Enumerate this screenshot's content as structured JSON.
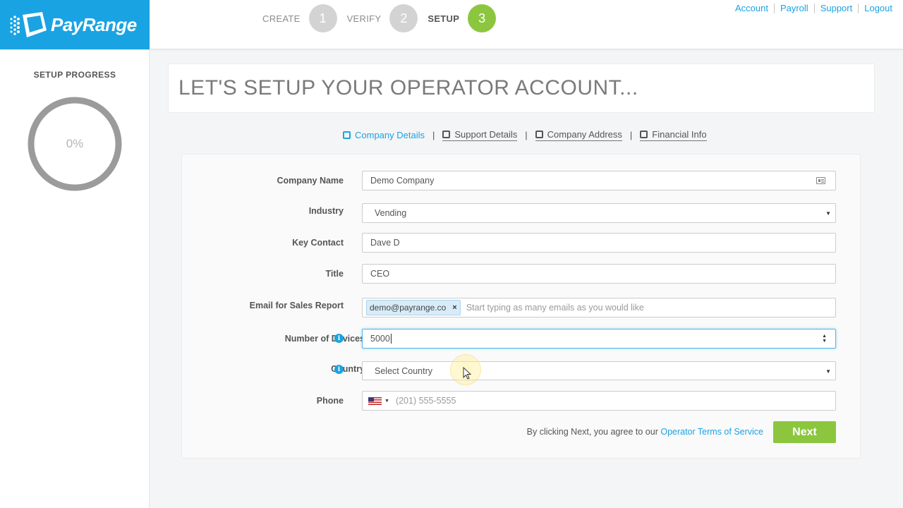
{
  "brand": {
    "name": "PayRange",
    "color": "#1aa3e3",
    "accent": "#8cc63f"
  },
  "steps": [
    {
      "label": "CREATE",
      "number": "1",
      "active": false
    },
    {
      "label": "VERIFY",
      "number": "2",
      "active": false
    },
    {
      "label": "SETUP",
      "number": "3",
      "active": true
    }
  ],
  "top_links": [
    "Account",
    "Payroll",
    "Support",
    "Logout"
  ],
  "sidebar": {
    "title": "SETUP PROGRESS",
    "progress_text": "0%",
    "progress_value": 0
  },
  "main": {
    "title": "LET'S SETUP YOUR OPERATOR ACCOUNT...",
    "tabs": [
      "Company Details",
      "Support Details",
      "Company Address",
      "Financial Info"
    ],
    "active_tab": "Company Details"
  },
  "form": {
    "company_name": {
      "label": "Company Name",
      "value": "Demo Company"
    },
    "industry": {
      "label": "Industry",
      "value": "Vending"
    },
    "key_contact": {
      "label": "Key Contact",
      "value": "Dave D"
    },
    "title": {
      "label": "Title",
      "value": "CEO"
    },
    "email": {
      "label": "Email for Sales Report",
      "tag": "demo@payrange.co",
      "placeholder": "Start typing as many emails as you would like"
    },
    "devices": {
      "label": "Number of Devices",
      "value": "5000"
    },
    "country": {
      "label": "Country",
      "placeholder": "Select Country"
    },
    "phone": {
      "label": "Phone",
      "placeholder": "(201) 555-5555",
      "flag": "us-flag-icon"
    }
  },
  "footer": {
    "agree_text": "By clicking Next, you agree to our ",
    "terms_link": "Operator Terms of Service",
    "next_label": "Next"
  }
}
